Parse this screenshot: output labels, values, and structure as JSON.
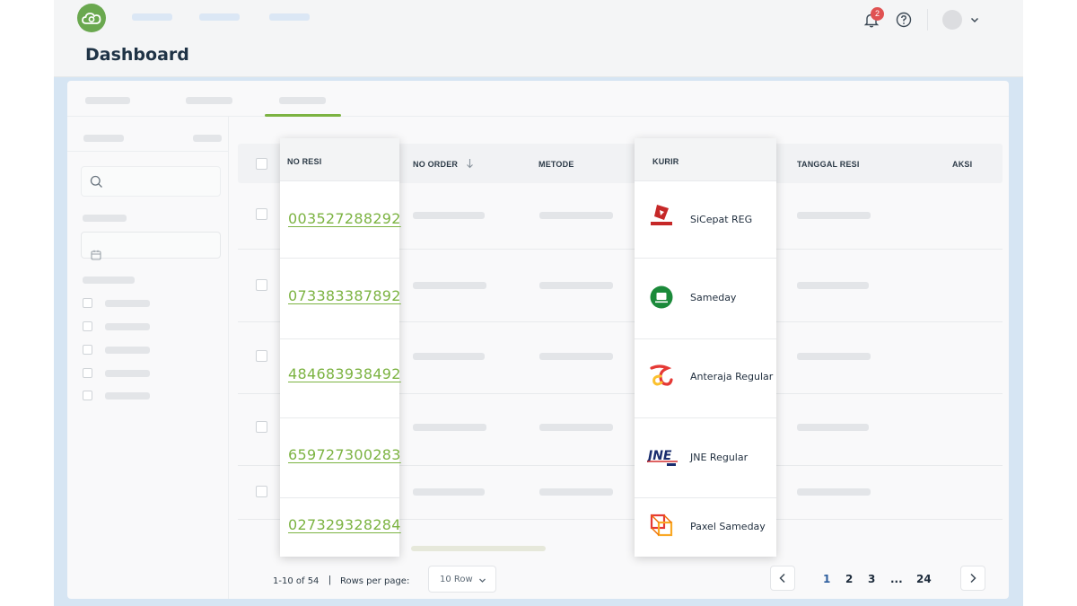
{
  "header": {
    "page_title": "Dashboard",
    "notification_count": "2"
  },
  "table": {
    "columns": {
      "no_resi": "NO RESI",
      "no_order": "NO ORDER",
      "metode": "METODE",
      "kurir": "KURIR",
      "tanggal_resi": "TANGGAL RESI",
      "aksi": "AKSI"
    },
    "rows": [
      {
        "no_resi": "003527288292",
        "kurir": "SiCepat REG",
        "kurir_icon": "sicepat-logo-icon"
      },
      {
        "no_resi": "073383387892",
        "kurir": "Sameday",
        "kurir_icon": "sameday-logo-icon"
      },
      {
        "no_resi": "484683938492",
        "kurir": "Anteraja Regular",
        "kurir_icon": "anteraja-logo-icon"
      },
      {
        "no_resi": "659727300283",
        "kurir": "JNE Regular",
        "kurir_icon": "jne-logo-icon"
      },
      {
        "no_resi": "027329328284",
        "kurir": "Paxel Sameday",
        "kurir_icon": "paxel-logo-icon"
      }
    ]
  },
  "pagination": {
    "range": "1-10 of 54",
    "separator": "|",
    "rows_per_page_label": "Rows per page:",
    "rows_per_page_value": "10 Row",
    "pages": [
      "1",
      "2",
      "3",
      "...",
      "24"
    ],
    "active_page": "1"
  },
  "colors": {
    "accent_green": "#7cb342",
    "brand_green": "#6aa84f",
    "content_bg": "#d6e5f3",
    "badge_red": "#e05252"
  }
}
